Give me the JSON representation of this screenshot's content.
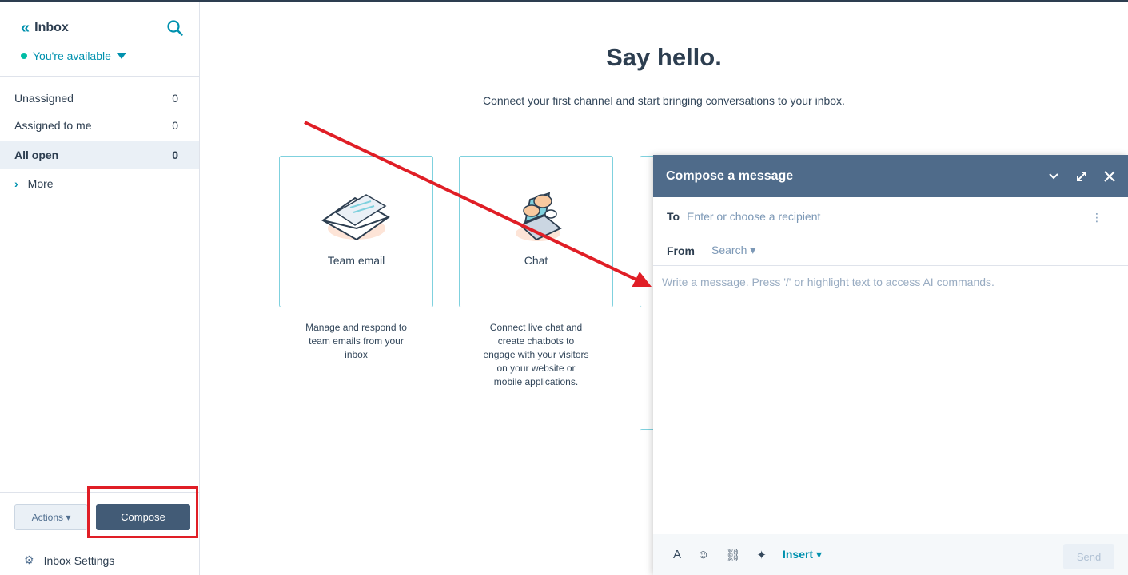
{
  "sidebar": {
    "title": "Inbox",
    "status": "You're available",
    "views": [
      {
        "label": "Unassigned",
        "count": "0"
      },
      {
        "label": "Assigned to me",
        "count": "0"
      },
      {
        "label": "All open",
        "count": "0"
      }
    ],
    "more_label": "More",
    "actions_label": "Actions ▾",
    "compose_label": "Compose",
    "settings_label": "Inbox Settings"
  },
  "main": {
    "heading": "Say hello.",
    "subtitle": "Connect your first channel and start bringing conversations to your inbox.",
    "cards": [
      {
        "label": "Team email",
        "desc_lines": [
          "Manage and respond to",
          "team emails from your",
          "inbox"
        ]
      },
      {
        "label": "Chat",
        "desc_lines": [
          "Connect live chat and",
          "create chatbots to",
          "engage with your visitors",
          "on your website or",
          "mobile applications."
        ]
      }
    ]
  },
  "compose": {
    "title": "Compose a message",
    "to_label": "To",
    "to_placeholder": "Enter or choose a recipient",
    "from_label": "From",
    "from_select": "Search ▾",
    "body_placeholder": "Write a message. Press '/' or highlight text to access AI commands.",
    "insert_label": "Insert ▾",
    "send_label": "Send"
  },
  "colors": {
    "accent": "#0091ae",
    "compose_header": "#4f6b8a",
    "compose_button": "#425b76",
    "annotation_red": "#e01e26"
  }
}
